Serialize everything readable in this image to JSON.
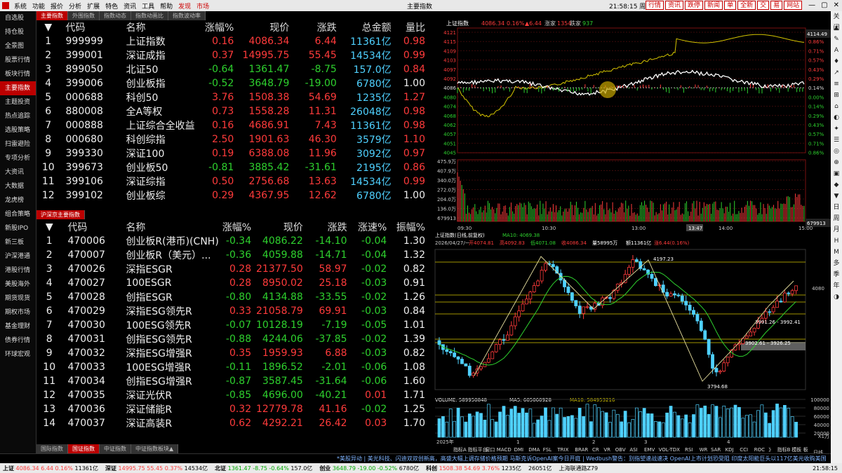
{
  "menu": [
    "系统",
    "功能",
    "报价",
    "分析",
    "扩展",
    "特色",
    "资讯",
    "工具",
    "帮助",
    "发现",
    "市场"
  ],
  "app_title": "主要指数",
  "clock": "21:58:15 周一",
  "top_buttons": [
    "行情",
    "资讯",
    "跌停",
    "新闻",
    "单",
    "全新",
    "交",
    "易",
    "网站"
  ],
  "window_controls": [
    "—",
    "▢",
    "✕"
  ],
  "left_nav": [
    "自选股",
    "持仓股",
    "全景图",
    "股票行情",
    "板块行情",
    "主要指数",
    "主题投资",
    "热点追踪",
    "选股策略",
    "扫雷避险",
    "专项分析",
    "大资讯",
    "大数据",
    "龙虎榜",
    "组合策略",
    "新股IPO",
    "新三板",
    "沪深港通",
    "港股行情",
    "美股海外",
    "期货现货",
    "期权市场",
    "基金理财",
    "债券行情",
    "环球宏观"
  ],
  "left_nav_active": 5,
  "tabs_top": [
    "主要指数",
    "外围指数",
    "指数动态",
    "指数动画比",
    "指数波动率"
  ],
  "table1": {
    "headers": [
      "代码",
      "名称",
      "涨幅%",
      "现价",
      "涨跌",
      "总金额",
      "量比"
    ],
    "rows": [
      [
        "1",
        "999999",
        "上证指数",
        "0.16",
        "4086.34",
        "6.44",
        "11361亿",
        "0.98",
        "r",
        "r"
      ],
      [
        "2",
        "399001",
        "深证成指",
        "0.37",
        "14995.75",
        "55.45",
        "14534亿",
        "0.99",
        "r",
        "r"
      ],
      [
        "3",
        "899050",
        "北证50",
        "-0.64",
        "1361.47",
        "-8.75",
        "157.0亿",
        "0.84",
        "g",
        "r"
      ],
      [
        "4",
        "399006",
        "创业板指",
        "-0.52",
        "3648.79",
        "-19.00",
        "6780亿",
        "1.00",
        "g",
        "w"
      ],
      [
        "5",
        "000688",
        "科创50",
        "3.76",
        "1508.38",
        "54.69",
        "1235亿",
        "1.27",
        "r",
        "r"
      ],
      [
        "6",
        "880008",
        "全A等权",
        "0.73",
        "1558.28",
        "11.31",
        "26048亿",
        "0.98",
        "r",
        "r"
      ],
      [
        "7",
        "000888",
        "上证综合全收益",
        "0.16",
        "4686.91",
        "7.43",
        "11361亿",
        "0.98",
        "r",
        "r"
      ],
      [
        "8",
        "000680",
        "科创综指",
        "2.50",
        "1901.63",
        "46.30",
        "3579亿",
        "1.10",
        "r",
        "r"
      ],
      [
        "9",
        "399330",
        "深证100",
        "0.19",
        "6388.08",
        "11.96",
        "3092亿",
        "0.97",
        "r",
        "r"
      ],
      [
        "10",
        "399673",
        "创业板50",
        "-0.81",
        "3885.42",
        "-31.61",
        "2195亿",
        "0.86",
        "g",
        "r"
      ],
      [
        "11",
        "399106",
        "深证综指",
        "0.50",
        "2756.68",
        "13.63",
        "14534亿",
        "0.99",
        "r",
        "r"
      ],
      [
        "12",
        "399102",
        "创业板综",
        "0.29",
        "4367.95",
        "12.62",
        "6780亿",
        "1.00",
        "r",
        "w"
      ]
    ]
  },
  "tabs_mid": [
    "沪深京主要指数"
  ],
  "table2": {
    "headers": [
      "代码",
      "名称",
      "涨幅%",
      "现价",
      "涨跌",
      "涨速%",
      "振幅%"
    ],
    "rows": [
      [
        "1",
        "470006",
        "创业板R(港币)(CNH)",
        "-0.34",
        "4086.22",
        "-14.10",
        "-0.04",
        "1.30"
      ],
      [
        "2",
        "470007",
        "创业板R（美元）...",
        "-0.36",
        "4059.88",
        "-14.71",
        "-0.04",
        "1.32"
      ],
      [
        "3",
        "470026",
        "深指ESGR",
        "0.28",
        "21377.50",
        "58.97",
        "-0.02",
        "0.82"
      ],
      [
        "4",
        "470027",
        "100ESGR",
        "0.28",
        "8950.02",
        "25.18",
        "-0.03",
        "0.91"
      ],
      [
        "5",
        "470028",
        "创指ESGR",
        "-0.80",
        "4134.88",
        "-33.55",
        "-0.02",
        "1.26"
      ],
      [
        "6",
        "470029",
        "深指ESG领先R",
        "0.33",
        "21058.79",
        "69.91",
        "-0.03",
        "0.84"
      ],
      [
        "7",
        "470030",
        "100ESG领先R",
        "-0.07",
        "10128.19",
        "-7.19",
        "-0.05",
        "1.01"
      ],
      [
        "8",
        "470031",
        "创指ESG领先R",
        "-0.88",
        "4244.06",
        "-37.85",
        "-0.02",
        "1.39"
      ],
      [
        "9",
        "470032",
        "深指ESG增强R",
        "0.35",
        "1959.93",
        "6.88",
        "-0.03",
        "0.82"
      ],
      [
        "10",
        "470033",
        "100ESG增强R",
        "-0.11",
        "1896.52",
        "-2.01",
        "-0.06",
        "1.08"
      ],
      [
        "11",
        "470034",
        "创指ESG增强R",
        "-0.87",
        "3587.45",
        "-31.64",
        "-0.06",
        "1.60"
      ],
      [
        "12",
        "470035",
        "深证光伏R",
        "-0.85",
        "4696.00",
        "-40.21",
        "0.01",
        "1.71"
      ],
      [
        "13",
        "470036",
        "深证储能R",
        "0.32",
        "12779.78",
        "41.16",
        "-0.02",
        "1.25"
      ],
      [
        "14",
        "470037",
        "深证高装R",
        "0.62",
        "4292.21",
        "26.42",
        "0.03",
        "1.70"
      ]
    ]
  },
  "tabs_bottom": [
    "国际指数",
    "国证指数",
    "中证指数",
    "中证指数板块▲"
  ],
  "right_bar": [
    "关闭",
    "▲",
    "✎",
    "A",
    "♦",
    "↗",
    "≡",
    "⊞",
    "⌂",
    "◐",
    "✦",
    "☰",
    "◎",
    "⊕",
    "▣",
    "◆",
    "▼",
    "日",
    "周",
    "月",
    "H",
    "M",
    "多",
    "季",
    "年",
    "◑"
  ],
  "intraday": {
    "title": "上证指数",
    "price": "4086.34",
    "pct": "0.16%",
    "chg": "▲6.44",
    "up_label": "涨家",
    "up": "1354",
    "down_label": "跌家",
    "down": "937",
    "price_axis": [
      "4121",
      "4115",
      "4109",
      "4103",
      "4097",
      "4092",
      "4086",
      "4080",
      "4074",
      "4068",
      "4062",
      "4057",
      "4051",
      "4045"
    ],
    "pct_axis": [
      "1.00%",
      "0.86%",
      "0.71%",
      "0.57%",
      "0.43%",
      "0.29%",
      "0.14%",
      "0.00%",
      "0.14%",
      "0.29%",
      "0.43%",
      "0.57%",
      "0.71%",
      "0.86%"
    ],
    "last_tag": "4114.49",
    "vol_axis": [
      "475.9万",
      "407.9万",
      "340.0万",
      "272.0万",
      "204.0万",
      "136.0万",
      "679913"
    ],
    "vol_tag": "679913",
    "time_axis": [
      "09:30",
      "10:30",
      "13:00",
      "14:00",
      "15:00"
    ],
    "time_tag": "13:47"
  },
  "kline": {
    "title": "上证指数(日线,前复权)",
    "ma_label": "MA10: 4069.38",
    "info_date": "2026/04/27/一",
    "open": "开4074.81",
    "high": "高4092.83",
    "low": "低4071.08",
    "close": "收4086.34",
    "volume": "量58995万",
    "amount": "额11361亿",
    "change": "涨6.44(0.16%)",
    "annotations": [
      "4197.23",
      "3991.26 - 3992.41",
      "3902.61 - 3926.25",
      "3794.68"
    ],
    "right_price": "4080",
    "right_unit": "日线",
    "vol_title": "VOLUME: 589950848",
    "ma5": "MA5: 605060928",
    "ma10": "MA10: 584953216",
    "vol_axis": [
      "100000",
      "80000",
      "60000",
      "40000",
      "20000"
    ],
    "vol_unit": "X1万",
    "x_labels": [
      "2025年",
      "1",
      "2",
      "3",
      "4"
    ],
    "indicators": [
      "指标A",
      "指标平台",
      "窗口",
      "MACD",
      "DMI",
      "DMA",
      "FSL",
      "TRIX",
      "BRAR",
      "CR",
      "VR",
      "OBV",
      "ASI",
      "EMV",
      "VOL-TDX",
      "RSI",
      "WR",
      "SAR",
      "KDJ",
      "CCI",
      "ROC",
      "》",
      "指标B",
      "模板",
      "板"
    ]
  },
  "ticker": "*美股异动 | 美光科技、闪迪双双创新高，高盛大幅上调存储价格预期    马斯克诉OpenAI案今日开庭 | Wedbush警告：别指望速战速决 OpenAI上市计划恐受阻    印度太阳能巨头以117亿美元收购美国制药商的加农",
  "status": {
    "sh_label": "上证",
    "sh_price": "4086.34",
    "sh_chg": "6.44",
    "sh_pct": "0.16%",
    "sh_amt": "11361亿",
    "sz_label": "深证",
    "sz_price": "14995.75",
    "sz_chg": "55.45",
    "sz_pct": "0.37%",
    "sz_amt": "14534亿",
    "bz_label": "北证",
    "bz_price": "1361.47",
    "bz_chg": "-8.75",
    "bz_pct": "-0.64%",
    "bz_amt": "157.0亿",
    "cy_label": "创业",
    "cy_price": "3648.79",
    "cy_chg": "-19.00",
    "cy_pct": "-0.52%",
    "cy_amt": "6780亿",
    "kc_label": "科创",
    "kc_price": "1508.38",
    "kc_chg": "54.69",
    "kc_pct": "3.76%",
    "kc_amt": "1235亿",
    "extra1": "26051亿",
    "server": "上海联通路Z79",
    "time": "21:58:15"
  },
  "colors": {
    "up": "#ff3b3b",
    "down": "#2ed12e",
    "accent": "#b00000",
    "price_line": "#ffffff",
    "avg_line": "#d4c400"
  }
}
